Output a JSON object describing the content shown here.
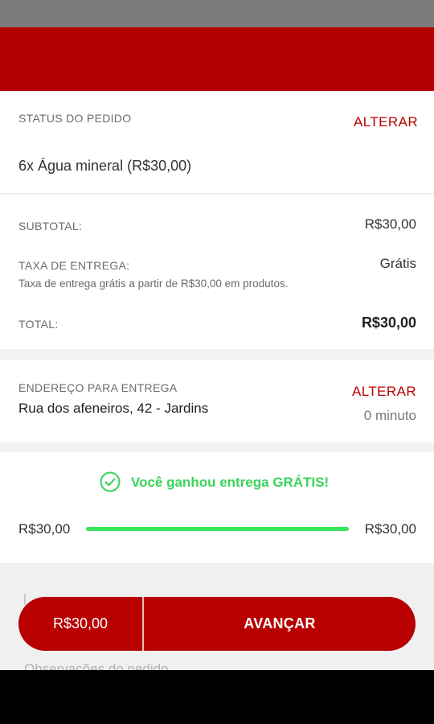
{
  "order": {
    "status_label": "STATUS DO PEDIDO",
    "change_label": "ALTERAR",
    "item": "6x Água mineral (R$30,00)"
  },
  "totals": {
    "subtotal_label": "SUBTOTAL:",
    "subtotal_value": "R$30,00",
    "fee_label": "TAXA DE ENTREGA:",
    "fee_value": "Grátis",
    "fee_note": "Taxa de entrega grátis a partir de R$30,00 em produtos.",
    "total_label": "TOTAL:",
    "total_value": "R$30,00"
  },
  "address": {
    "label": "ENDEREÇO PARA ENTREGA",
    "change_label": "ALTERAR",
    "street": "Rua dos afeneiros, 42 - Jardins",
    "eta": "0 minuto"
  },
  "free_delivery": {
    "message": "Você ganhou entrega GRÁTIS!",
    "progress_start": "R$30,00",
    "progress_end": "R$30,00",
    "progress_fraction": 1.0,
    "accent": "#39d35a"
  },
  "notes": {
    "placeholder": "Observações do pedido"
  },
  "action": {
    "price": "R$30,00",
    "advance_label": "AVANÇAR"
  },
  "colors": {
    "brand_red": "#b30000",
    "success_green": "#39d35a"
  }
}
